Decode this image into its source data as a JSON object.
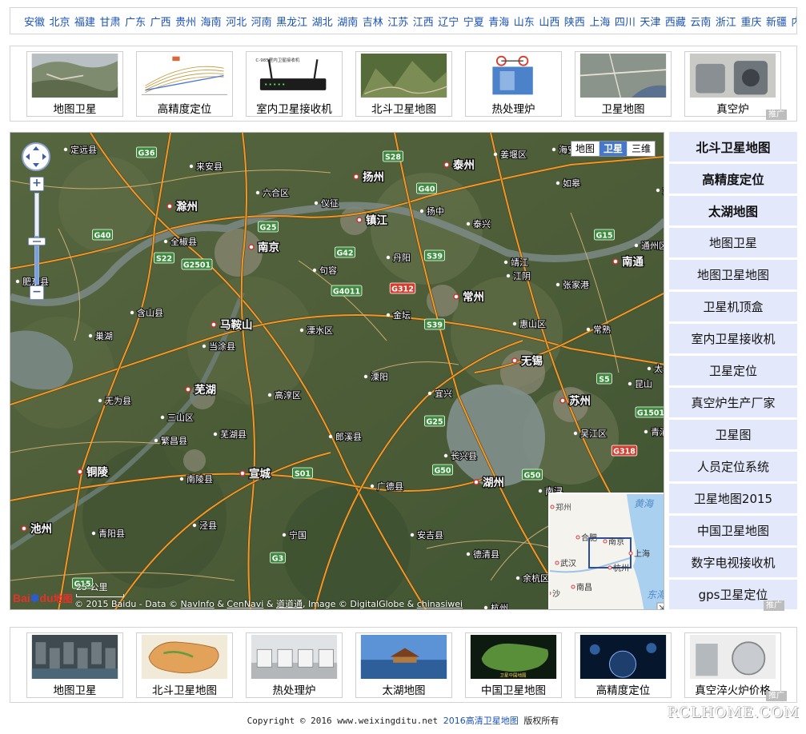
{
  "provinces": [
    "安徽",
    "北京",
    "福建",
    "甘肃",
    "广东",
    "广西",
    "贵州",
    "海南",
    "河北",
    "河南",
    "黑龙江",
    "湖北",
    "湖南",
    "吉林",
    "江苏",
    "江西",
    "辽宁",
    "宁夏",
    "青海",
    "山东",
    "山西",
    "陕西",
    "上海",
    "四川",
    "天津",
    "西藏",
    "云南",
    "浙江",
    "重庆",
    "新疆",
    "内蒙古"
  ],
  "top_strip": {
    "items": [
      {
        "label": "地图卫星",
        "thumb": "terrain-photo"
      },
      {
        "label": "高精度定位",
        "thumb": "diagram"
      },
      {
        "label": "室内卫星接收机",
        "thumb": "router-device",
        "thumb_text": "C-985室内卫星接收机"
      },
      {
        "label": "北斗卫星地图",
        "thumb": "mountain-photo"
      },
      {
        "label": "热处理炉",
        "thumb": "furnace-machine"
      },
      {
        "label": "卫星地图",
        "thumb": "city-satellite"
      },
      {
        "label": "真空炉",
        "thumb": "vacuum-furnace"
      }
    ],
    "ad_label": "推广"
  },
  "map": {
    "type_buttons": [
      {
        "label": "地图",
        "active": false
      },
      {
        "label": "卫星",
        "active": true
      },
      {
        "label": "三维",
        "active": false
      }
    ],
    "zoom_in": "+",
    "zoom_out": "−",
    "scale_label": "25 公里",
    "logo": {
      "bai": "Bai",
      "du": "du",
      "map": "地图"
    },
    "copyright": {
      "prefix": "© 2015 Baidu - Data ©",
      "navinfo": "NavInfo",
      "amp": "&",
      "cennavi": "CenNavi",
      "amp2": "&",
      "ddt": "道道通",
      "image": ", Image © DigitalGlobe &",
      "chinasiwei": "chinasiwei"
    },
    "cities": [
      {
        "name": "扬州",
        "major": true
      },
      {
        "name": "泰州",
        "major": true
      },
      {
        "name": "镇江",
        "major": true
      },
      {
        "name": "南京",
        "major": true
      },
      {
        "name": "滁州",
        "major": true
      },
      {
        "name": "常州",
        "major": true
      },
      {
        "name": "无锡",
        "major": true
      },
      {
        "name": "苏州",
        "major": true
      },
      {
        "name": "马鞍山",
        "major": true
      },
      {
        "name": "芜湖",
        "major": true
      },
      {
        "name": "宣城",
        "major": true
      },
      {
        "name": "湖州",
        "major": true
      },
      {
        "name": "铜陵",
        "major": true
      },
      {
        "name": "池州",
        "major": true
      },
      {
        "name": "南通",
        "major": true
      },
      {
        "name": "定远县",
        "major": false
      },
      {
        "name": "来安县",
        "major": false
      },
      {
        "name": "六合区",
        "major": false
      },
      {
        "name": "仪征",
        "major": false
      },
      {
        "name": "扬中",
        "major": false
      },
      {
        "name": "泰兴",
        "major": false
      },
      {
        "name": "姜堰区",
        "major": false
      },
      {
        "name": "海安县",
        "major": false
      },
      {
        "name": "如皋",
        "major": false
      },
      {
        "name": "全椒县",
        "major": false
      },
      {
        "name": "句容",
        "major": false
      },
      {
        "name": "丹阳",
        "major": false
      },
      {
        "name": "靖江",
        "major": false
      },
      {
        "name": "江阴",
        "major": false
      },
      {
        "name": "张家港",
        "major": false
      },
      {
        "name": "通州区",
        "major": false
      },
      {
        "name": "含山县",
        "major": false
      },
      {
        "name": "金坛",
        "major": false
      },
      {
        "name": "惠山区",
        "major": false
      },
      {
        "name": "常熟",
        "major": false
      },
      {
        "name": "巢湖",
        "major": false
      },
      {
        "name": "当涂县",
        "major": false
      },
      {
        "name": "溧水区",
        "major": false
      },
      {
        "name": "溧阳",
        "major": false
      },
      {
        "name": "宜兴",
        "major": false
      },
      {
        "name": "太仓",
        "major": false
      },
      {
        "name": "昆山",
        "major": false
      },
      {
        "name": "无为县",
        "major": false
      },
      {
        "name": "高淳区",
        "major": false
      },
      {
        "name": "三山区",
        "major": false
      },
      {
        "name": "吴江区",
        "major": false
      },
      {
        "name": "青浦",
        "major": false
      },
      {
        "name": "繁昌县",
        "major": false
      },
      {
        "name": "芜湖县",
        "major": false
      },
      {
        "name": "郎溪县",
        "major": false
      },
      {
        "name": "长兴县",
        "major": false
      },
      {
        "name": "南陵县",
        "major": false
      },
      {
        "name": "广德县",
        "major": false
      },
      {
        "name": "南浔",
        "major": false
      },
      {
        "name": "泾县",
        "major": false
      },
      {
        "name": "青阳县",
        "major": false
      },
      {
        "name": "宁国",
        "major": false
      },
      {
        "name": "安吉县",
        "major": false
      },
      {
        "name": "德清县",
        "major": false
      },
      {
        "name": "余杭区",
        "major": false
      },
      {
        "name": "肥东县",
        "major": false
      },
      {
        "name": "杭州",
        "major": false
      },
      {
        "name": "如",
        "major": false
      }
    ],
    "highways": [
      "G36",
      "S28",
      "G40",
      "G25",
      "G42",
      "G2501",
      "S22",
      "G40",
      "S39",
      "G4011",
      "G312",
      "S39",
      "G15",
      "S5",
      "G1501",
      "G25",
      "G50",
      "G318",
      "G50",
      "S01",
      "G3",
      "G15"
    ],
    "overview": {
      "labels": [
        "郑州",
        "黄海",
        "合肥",
        "南京",
        "上海",
        "武汉",
        "杭州",
        "南昌",
        "沙",
        "东海"
      ]
    }
  },
  "right_list": {
    "items": [
      {
        "label": "北斗卫星地图",
        "bold": true
      },
      {
        "label": "高精度定位",
        "bold": true
      },
      {
        "label": "太湖地图",
        "bold": true
      },
      {
        "label": "地图卫星",
        "bold": false
      },
      {
        "label": "地图卫星地图",
        "bold": false
      },
      {
        "label": "卫星机顶盒",
        "bold": false
      },
      {
        "label": "室内卫星接收机",
        "bold": false
      },
      {
        "label": "卫星定位",
        "bold": false
      },
      {
        "label": "真空炉生产厂家",
        "bold": false
      },
      {
        "label": "卫星图",
        "bold": false
      },
      {
        "label": "人员定位系统",
        "bold": false
      },
      {
        "label": "卫星地图2015",
        "bold": false
      },
      {
        "label": "中国卫星地图",
        "bold": false
      },
      {
        "label": "数字电视接收机",
        "bold": false
      },
      {
        "label": "gps卫星定位",
        "bold": false
      }
    ],
    "ad_label": "推广"
  },
  "bottom_strip": {
    "items": [
      {
        "label": "地图卫星",
        "thumb": "city-aerial"
      },
      {
        "label": "北斗卫星地图",
        "thumb": "china-map"
      },
      {
        "label": "热处理炉",
        "thumb": "factory-line"
      },
      {
        "label": "太湖地图",
        "thumb": "lake-pavilion"
      },
      {
        "label": "中国卫星地图",
        "thumb": "china-3d",
        "thumb_text": "卫星中国地图"
      },
      {
        "label": "高精度定位",
        "thumb": "space-tech"
      },
      {
        "label": "真空淬火炉价格",
        "thumb": "quench-furnace"
      }
    ],
    "ad_label": "推广"
  },
  "footer": {
    "copyright": "Copyright © 2016 www.weixingditu.net",
    "link": "2016高清卫星地图",
    "suffix": "版权所有"
  },
  "watermark": "RCLHOME.COM"
}
